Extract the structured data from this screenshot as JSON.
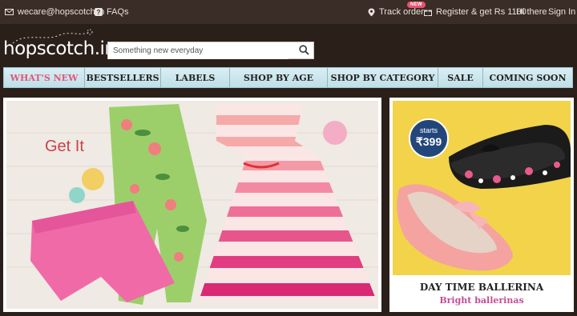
{
  "topbar": {
    "email": "wecare@hopscotch.in",
    "faqs": "FAQs",
    "track_order": "Track order",
    "new_badge": "NEW",
    "register": "Register & get Rs 1100",
    "greeting": "Hi there",
    "sign_in": "Sign In"
  },
  "header": {
    "logo_text": "hopscotch.in",
    "search_placeholder": "Something new everyday"
  },
  "nav": {
    "tabs": [
      {
        "label": "WHAT'S NEW"
      },
      {
        "label": "BESTSELLERS"
      },
      {
        "label": "LABELS"
      },
      {
        "label": "SHOP BY AGE"
      },
      {
        "label": "SHOP BY CATEGORY"
      },
      {
        "label": "SALE"
      },
      {
        "label": "COMING SOON"
      }
    ]
  },
  "main_banner": {
    "headline": "Get It"
  },
  "side_banner": {
    "badge_top": "starts",
    "badge_price": "₹399",
    "title": "DAY TIME BALLERINA",
    "subtitle": "Bright ballerinas"
  },
  "colors": {
    "accent_pink": "#e0577a",
    "nav_blue": "#cfe8ee",
    "subtitle_magenta": "#c04f95",
    "badge_navy": "#23467a"
  }
}
